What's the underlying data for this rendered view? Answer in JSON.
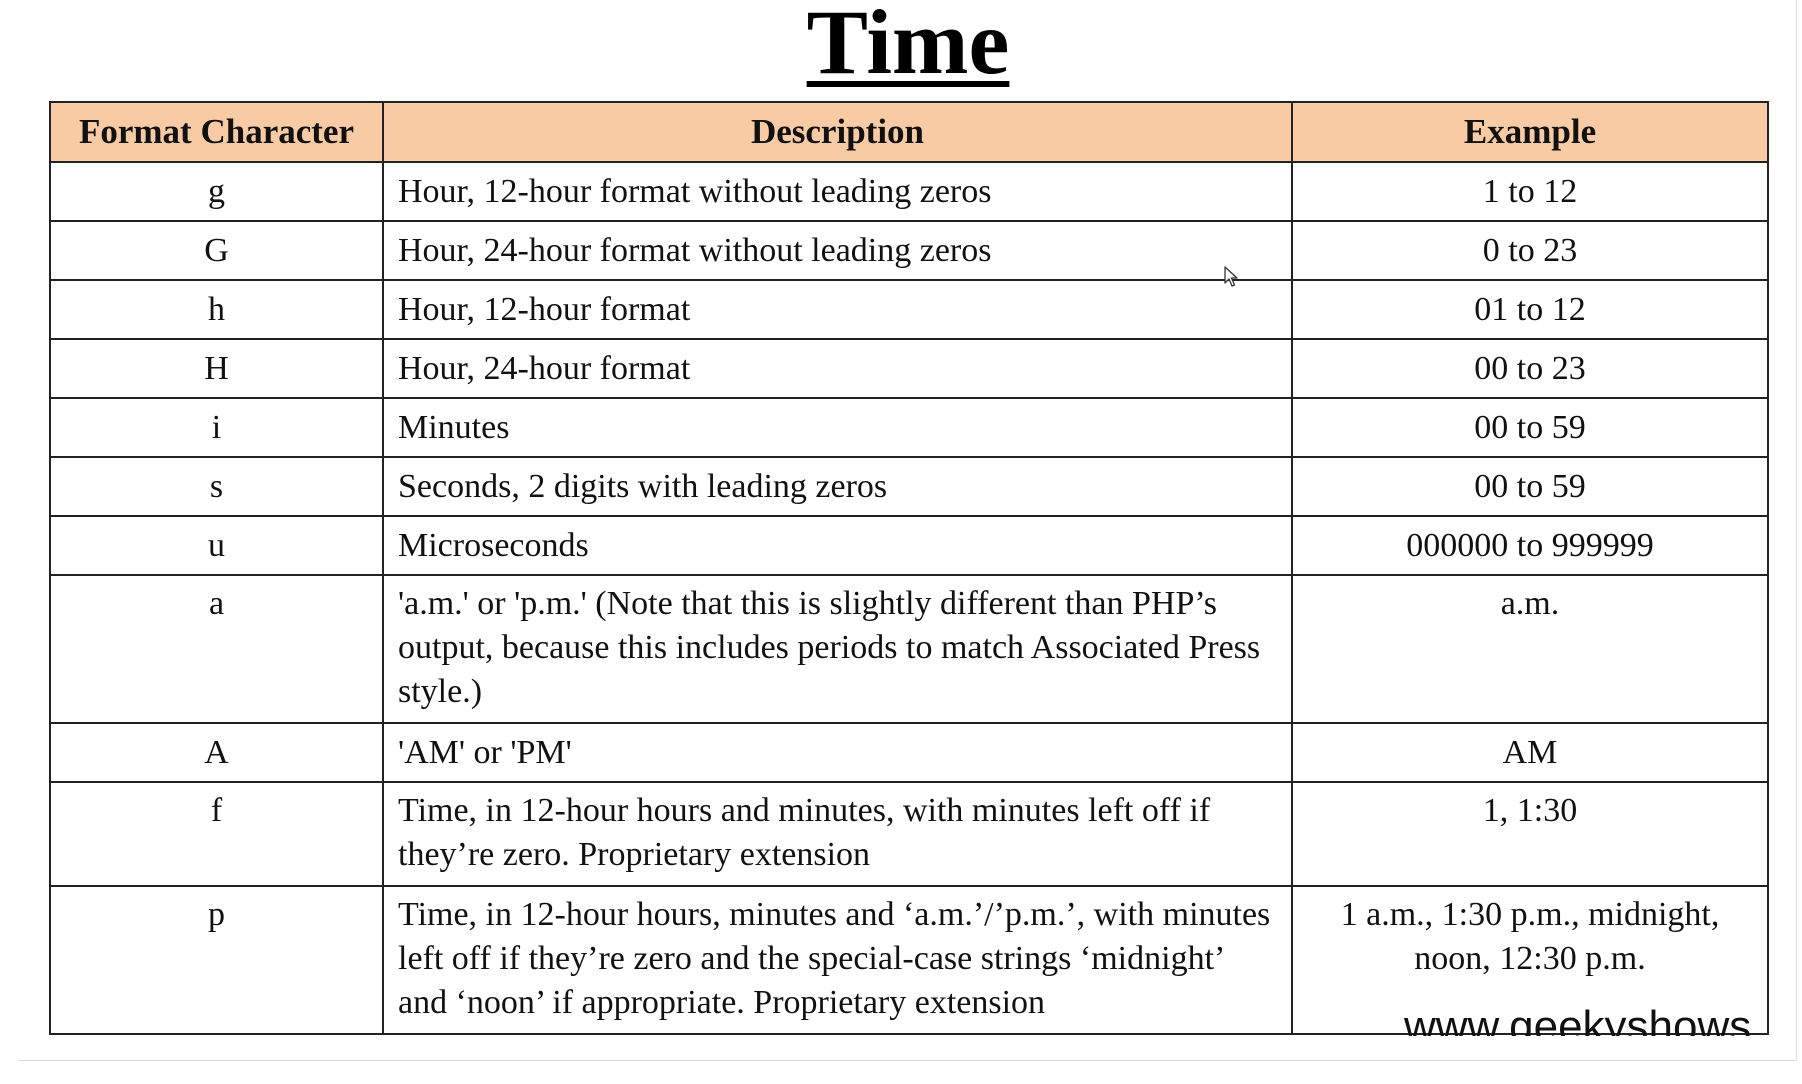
{
  "page": {
    "title": "Time",
    "watermark": "www.geekyshows"
  },
  "table": {
    "headers": [
      "Format Character",
      "Description",
      "Example"
    ],
    "rows": [
      {
        "format": "g",
        "description": "Hour, 12-hour format without leading zeros",
        "example": "1 to 12"
      },
      {
        "format": "G",
        "description": "Hour, 24-hour format without leading zeros",
        "example": "0 to 23"
      },
      {
        "format": "h",
        "description": "Hour, 12-hour format",
        "example": "01 to 12"
      },
      {
        "format": "H",
        "description": "Hour, 24-hour format",
        "example": "00 to 23"
      },
      {
        "format": "i",
        "description": "Minutes",
        "example": "00 to 59"
      },
      {
        "format": "s",
        "description": "Seconds, 2 digits with leading zeros",
        "example": "00 to 59"
      },
      {
        "format": "u",
        "description": "Microseconds",
        "example": "000000 to 999999"
      },
      {
        "format": "a",
        "description": "'a.m.' or 'p.m.' (Note that this is slightly different than PHP’s output, because this includes periods to match Associated Press style.)",
        "example": "a.m."
      },
      {
        "format": "A",
        "description": "'AM' or 'PM'",
        "example": "AM"
      },
      {
        "format": "f",
        "description": "Time, in 12-hour hours and minutes, with minutes left off if they’re zero. Proprietary extension",
        "example": "1, 1:30"
      },
      {
        "format": "p",
        "description": "Time, in 12-hour hours, minutes and ‘a.m.’/’p.m.’, with minutes left off if they’re zero and the special-case strings ‘midnight’ and ‘noon’ if appropriate. Proprietary extension",
        "example": "1 a.m., 1:30 p.m., midnight, noon, 12:30 p.m."
      }
    ]
  },
  "colors": {
    "header_background": "#f8cba4",
    "border": "#222222"
  },
  "icons": {
    "cursor": "mouse-pointer-icon"
  }
}
